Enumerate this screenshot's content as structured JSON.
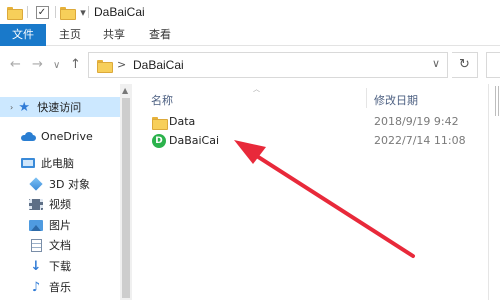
{
  "window": {
    "title": "DaBaiCai"
  },
  "quick_access_toolbar": {
    "dropdown_glyph": "▾",
    "check_glyph": "✓"
  },
  "ribbon": {
    "tabs": [
      {
        "label": "文件",
        "active": true
      },
      {
        "label": "主页"
      },
      {
        "label": "共享"
      },
      {
        "label": "查看"
      }
    ]
  },
  "nav": {
    "back_glyph": "←",
    "forward_glyph": "→",
    "recent_glyph": "∨",
    "up_glyph": "↑",
    "refresh_glyph": "↻",
    "address": {
      "separator": ">",
      "crumb": "DaBaiCai",
      "dropdown_glyph": "∨"
    }
  },
  "sidebar": {
    "items": [
      {
        "label": "快速访问",
        "icon": "star-icon"
      },
      {
        "label": "OneDrive",
        "icon": "cloud-icon"
      },
      {
        "label": "此电脑",
        "icon": "monitor-icon"
      },
      {
        "label": "3D 对象",
        "icon": "cube-icon"
      },
      {
        "label": "视频",
        "icon": "video-icon"
      },
      {
        "label": "图片",
        "icon": "picture-icon"
      },
      {
        "label": "文档",
        "icon": "document-icon"
      },
      {
        "label": "下载",
        "icon": "download-icon"
      },
      {
        "label": "音乐",
        "icon": "music-icon"
      }
    ]
  },
  "file_list": {
    "columns": {
      "name": "名称",
      "modified": "修改日期"
    },
    "rows": [
      {
        "name": "Data",
        "modified": "2018/9/19 9:42",
        "icon": "folder-icon"
      },
      {
        "name": "DaBaiCai",
        "modified": "2022/7/14 11:08",
        "icon": "app-icon"
      }
    ]
  },
  "colors": {
    "file_tab": "#1979ca",
    "selection": "#cce8ff",
    "folder": "#f7cf5a",
    "app_icon": "#2bb24c",
    "annotation_arrow": "#e8293a"
  }
}
